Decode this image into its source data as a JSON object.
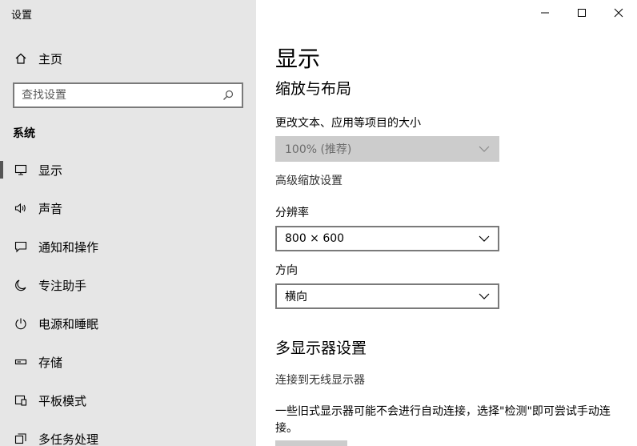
{
  "app": {
    "title": "设置"
  },
  "sidebar": {
    "home_label": "主页",
    "search": {
      "placeholder": "查找设置"
    },
    "section_label": "系统",
    "items": [
      {
        "label": "显示",
        "icon": "monitor-icon",
        "active": true
      },
      {
        "label": "声音",
        "icon": "speaker-icon",
        "active": false
      },
      {
        "label": "通知和操作",
        "icon": "message-icon",
        "active": false
      },
      {
        "label": "专注助手",
        "icon": "moon-icon",
        "active": false
      },
      {
        "label": "电源和睡眠",
        "icon": "power-icon",
        "active": false
      },
      {
        "label": "存储",
        "icon": "storage-icon",
        "active": false
      },
      {
        "label": "平板模式",
        "icon": "tablet-icon",
        "active": false
      },
      {
        "label": "多任务处理",
        "icon": "multitask-icon",
        "active": false
      }
    ]
  },
  "window_controls": {
    "minimize": "minimize-icon",
    "maximize": "maximize-icon",
    "close": "close-icon"
  },
  "main": {
    "title": "显示",
    "scale_section": {
      "heading": "缩放与布局",
      "scale_label": "更改文本、应用等项目的大小",
      "scale_value": "100% (推荐)",
      "advanced_link": "高级缩放设置",
      "resolution_label": "分辨率",
      "resolution_value": "800 × 600",
      "orientation_label": "方向",
      "orientation_value": "横向"
    },
    "multi_section": {
      "heading": "多显示器设置",
      "wireless_link": "连接到无线显示器",
      "description": "一些旧式显示器可能不会进行自动连接，选择\"检测\"即可尝试手动连接。"
    }
  }
}
